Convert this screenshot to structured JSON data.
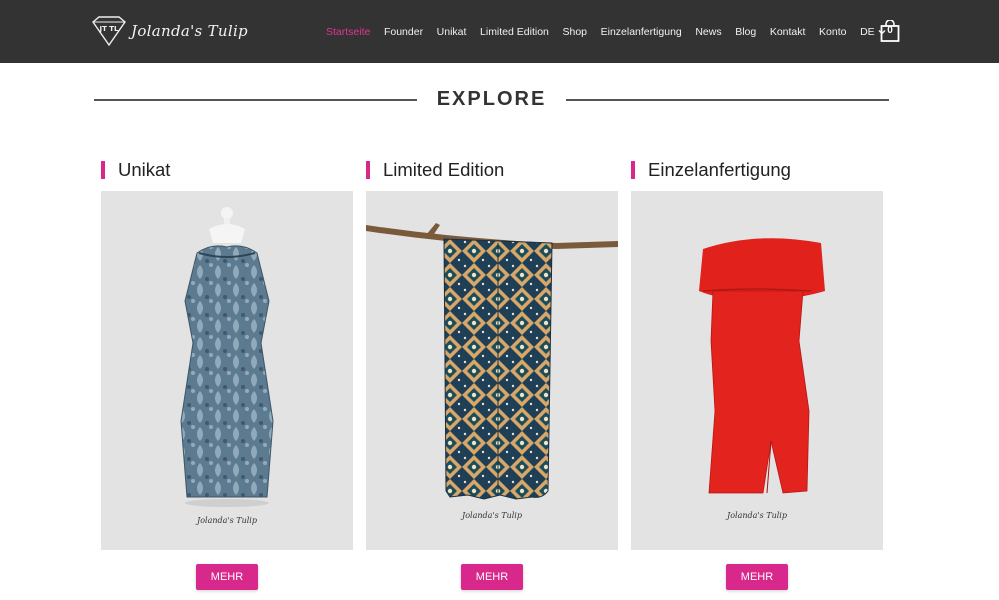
{
  "brand": {
    "name": "Jolanda's Tulip",
    "monogram": "JT TL"
  },
  "nav": {
    "items": [
      "Startseite",
      "Founder",
      "Unikat",
      "Limited Edition",
      "Shop",
      "Einzelanfertigung",
      "News",
      "Blog",
      "Kontakt",
      "Konto"
    ],
    "active": "Startseite",
    "language": "DE",
    "cart_count": "0"
  },
  "section": {
    "title": "EXPLORE"
  },
  "cards": [
    {
      "title": "Unikat",
      "button": "MEHR",
      "image_caption": "Jolanda's Tulip",
      "image": "blue-brocade-dress"
    },
    {
      "title": "Limited Edition",
      "button": "MEHR",
      "image_caption": "Jolanda's Tulip",
      "image": "african-print-scarf"
    },
    {
      "title": "Einzelanfertigung",
      "button": "MEHR",
      "image_caption": "Jolanda's Tulip",
      "image": "red-off-shoulder-dress"
    }
  ],
  "colors": {
    "header_bg": "#333333",
    "accent": "#d8288b",
    "active_nav": "#e0358f",
    "image_bg": "#e3e3e3"
  }
}
